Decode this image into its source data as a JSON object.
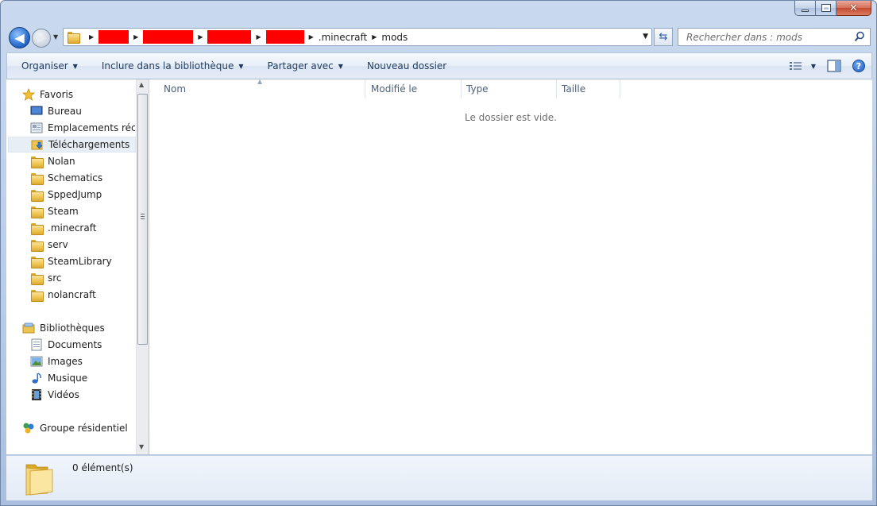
{
  "window": {
    "caption": {
      "close_symbol": "✕"
    }
  },
  "address_bar": {
    "breadcrumbs": [
      {
        "label": "",
        "redacted": true
      },
      {
        "label": "",
        "redacted": true
      },
      {
        "label": "",
        "redacted": true
      },
      {
        "label": "",
        "redacted": true
      },
      {
        "label": ".minecraft",
        "redacted": false
      },
      {
        "label": "mods",
        "redacted": false
      }
    ],
    "search_placeholder": "Rechercher dans : mods"
  },
  "toolbar": {
    "organize": "Organiser",
    "include_library": "Inclure dans la bibliothèque",
    "share_with": "Partager avec",
    "new_folder": "Nouveau dossier",
    "help_symbol": "?"
  },
  "navigation": {
    "favorites_header": "Favoris",
    "favorites": [
      {
        "label": "Bureau",
        "icon": "desktop-icon"
      },
      {
        "label": "Emplacements récents",
        "icon": "recent-places-icon"
      },
      {
        "label": "Téléchargements",
        "icon": "downloads-icon",
        "selected": true
      },
      {
        "label": "Nolan",
        "icon": "folder-icon"
      },
      {
        "label": "Schematics",
        "icon": "folder-icon"
      },
      {
        "label": "SppedJump",
        "icon": "folder-icon"
      },
      {
        "label": "Steam",
        "icon": "folder-icon"
      },
      {
        "label": ".minecraft",
        "icon": "folder-icon"
      },
      {
        "label": "serv",
        "icon": "folder-icon"
      },
      {
        "label": "SteamLibrary",
        "icon": "folder-icon"
      },
      {
        "label": "src",
        "icon": "folder-icon"
      },
      {
        "label": "nolancraft",
        "icon": "folder-icon"
      }
    ],
    "libraries_header": "Bibliothèques",
    "libraries": [
      {
        "label": "Documents",
        "icon": "documents-icon"
      },
      {
        "label": "Images",
        "icon": "images-icon"
      },
      {
        "label": "Musique",
        "icon": "music-icon"
      },
      {
        "label": "Vidéos",
        "icon": "videos-icon"
      }
    ],
    "homegroup": "Groupe résidentiel"
  },
  "content": {
    "columns": [
      "Nom",
      "Modifié le",
      "Type",
      "Taille"
    ],
    "empty_message": "Le dossier est vide."
  },
  "details": {
    "item_count": "0 élément(s)"
  },
  "colors": {
    "redaction": "#ff0000",
    "selected_row": "#e8eef6"
  }
}
